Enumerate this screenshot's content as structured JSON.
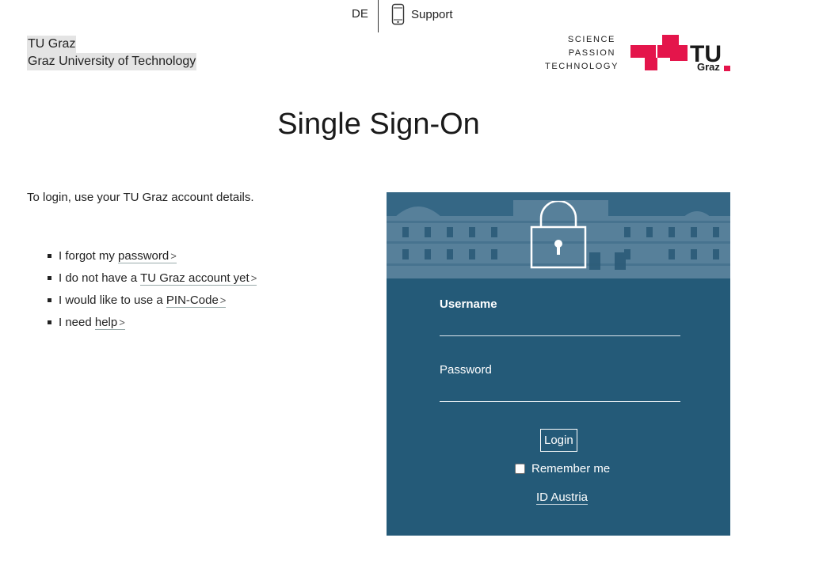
{
  "header": {
    "language": "DE",
    "support_label": "Support",
    "support_icon": "smartphone-icon"
  },
  "org": {
    "name": "TU Graz",
    "full_name": "Graz University of Technology"
  },
  "logo": {
    "tagline": [
      "SCIENCE",
      "PASSION",
      "TECHNOLOGY"
    ],
    "wordmark_tu": "TU",
    "wordmark_graz": "Graz",
    "brand_color": "#e4154b"
  },
  "page_title": "Single Sign-On",
  "intro": "To login, use your TU Graz account details.",
  "help_links": [
    {
      "prefix": "I forgot my ",
      "link": "password"
    },
    {
      "prefix": "I do not have a ",
      "link": "TU Graz account yet"
    },
    {
      "prefix": "I would like to use a ",
      "link": "PIN-Code"
    },
    {
      "prefix": "I need ",
      "link": "help"
    }
  ],
  "login_form": {
    "panel_color": "#245a78",
    "lock_icon": "padlock-icon",
    "username_label": "Username",
    "username_value": "",
    "password_label": "Password",
    "password_value": "",
    "login_button": "Login",
    "remember_label": "Remember me",
    "remember_checked": false,
    "id_austria_link": "ID Austria"
  }
}
